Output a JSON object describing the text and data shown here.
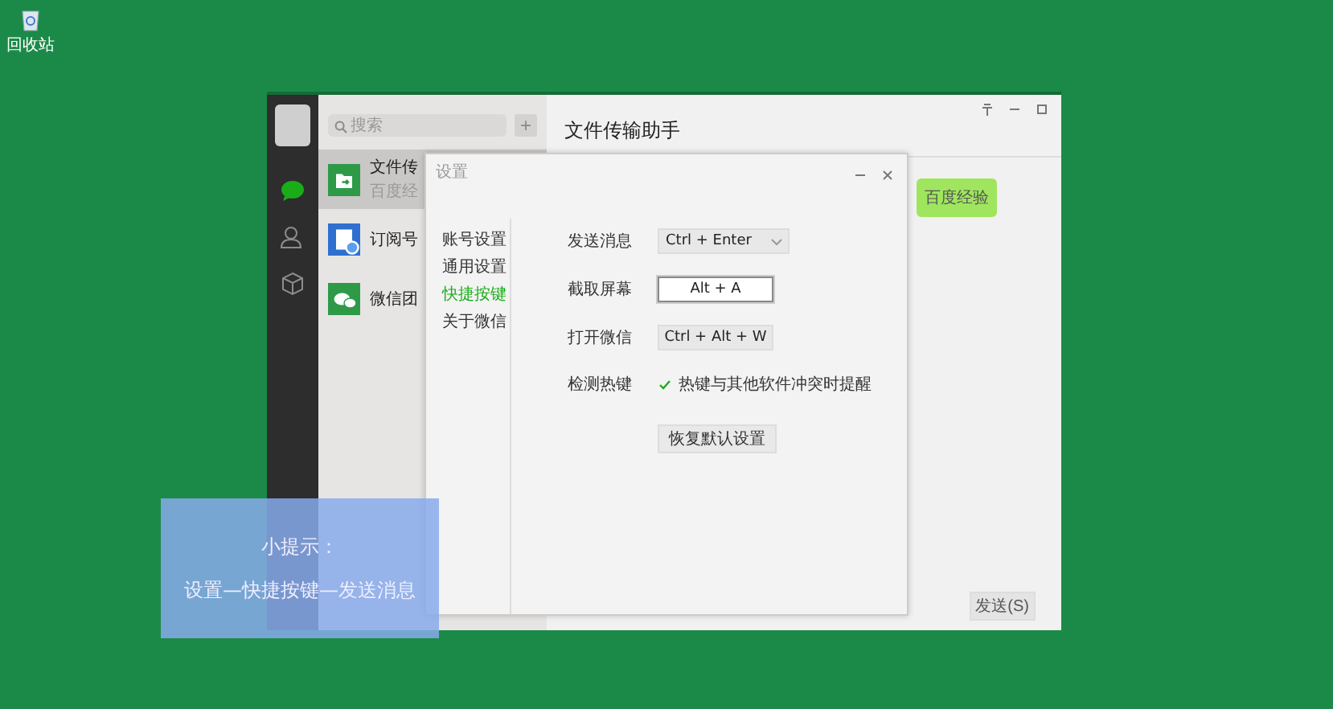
{
  "desktop_icons": [
    {
      "label": "回收站"
    }
  ],
  "wechat": {
    "nav": [
      {
        "kind": "chat",
        "selected": true
      },
      {
        "kind": "contacts",
        "selected": false
      },
      {
        "kind": "box",
        "selected": false
      }
    ],
    "search": {
      "placeholder": "搜索"
    },
    "add_button": "+",
    "chats": [
      {
        "name": "文件传",
        "preview": "百度经",
        "selected": true
      },
      {
        "name": "订阅号",
        "selected": false
      },
      {
        "name": "微信团",
        "selected": false
      }
    ],
    "chat_title": "文件传输助手",
    "message": "百度经验",
    "send_button": "发送(S)"
  },
  "settings": {
    "title": "设置",
    "nav": [
      {
        "label": "账号设置",
        "selected": false
      },
      {
        "label": "通用设置",
        "selected": false
      },
      {
        "label": "快捷按键",
        "selected": true
      },
      {
        "label": "关于微信",
        "selected": false
      }
    ],
    "rows": [
      {
        "kind": "dropdown",
        "label": "发送消息",
        "value": "Ctrl + Enter",
        "focused": false
      },
      {
        "kind": "key",
        "label": "截取屏幕",
        "value": "Alt + A",
        "focused": true
      },
      {
        "kind": "key",
        "label": "打开微信",
        "value": "Ctrl + Alt + W",
        "focused": false
      },
      {
        "kind": "checkbox",
        "label": "检测热键",
        "text": "热键与其他软件冲突时提醒",
        "checked": true
      }
    ],
    "restore_button": "恢复默认设置"
  },
  "tip": {
    "title": "小提示：",
    "text": "设置—快捷按键—发送消息"
  }
}
